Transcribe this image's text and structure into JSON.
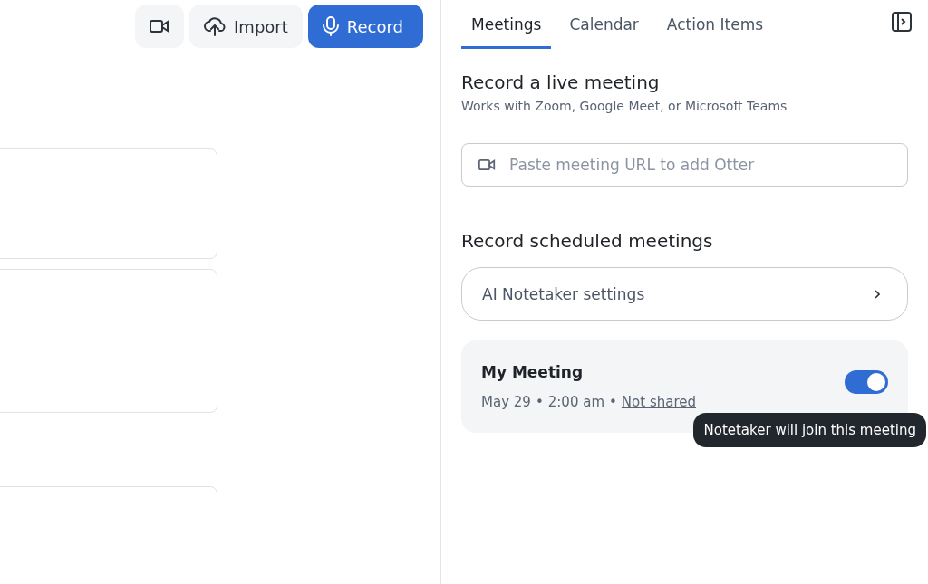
{
  "toolbar": {
    "buttons": [
      {
        "kind": "video"
      },
      {
        "kind": "import",
        "label": "Import"
      },
      {
        "kind": "record",
        "label": "Record"
      }
    ]
  },
  "left_cards": [
    {
      "kind": "card"
    },
    {
      "kind": "card"
    },
    {
      "kind": "card"
    }
  ],
  "tabs": [
    {
      "label": "Meetings",
      "selected": true
    },
    {
      "label": "Calendar",
      "selected": false
    },
    {
      "label": "Action Items",
      "selected": false
    }
  ],
  "live": {
    "title": "Record a live meeting",
    "subtitle": "Works with Zoom, Google Meet, or Microsoft Teams",
    "placeholder": "Paste meeting URL to add Otter"
  },
  "scheduled": {
    "title": "Record scheduled meetings",
    "settings_label": "AI Notetaker settings"
  },
  "meeting": {
    "title": "My Meeting",
    "date": "May 29",
    "time": "2:00 am",
    "separator": "•",
    "sharing": "Not shared",
    "on": true,
    "tooltip": "Notetaker will join this meeting"
  }
}
